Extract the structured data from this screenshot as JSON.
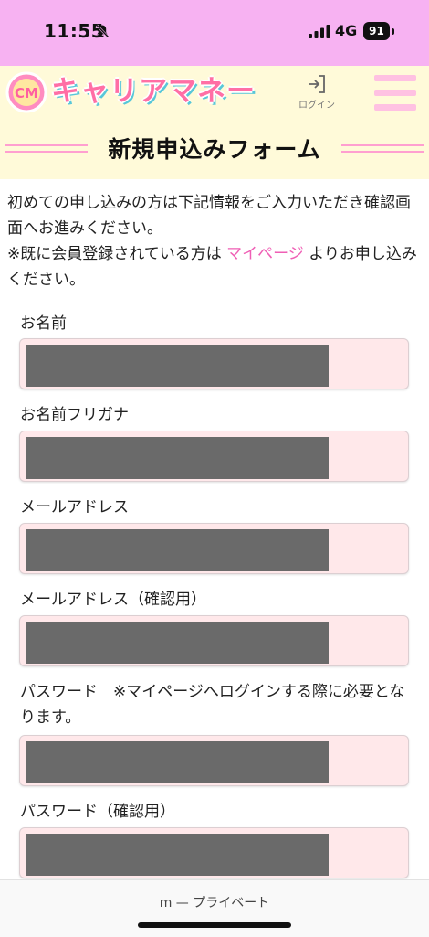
{
  "status_bar": {
    "time": "11:55",
    "network": "4G",
    "battery": "91"
  },
  "header": {
    "logo_mark": "CM",
    "logo_text": "キャリアマネー",
    "login_label": "ログイン"
  },
  "title": "新規申込みフォーム",
  "intro": {
    "line1": "初めての申し込みの方は下記情報をご入力いただき確認画面へお進みください。",
    "line2_prefix": "※既に会員登録されている方は ",
    "mypage_link": "マイページ",
    "line2_suffix": " よりお申し込みください。"
  },
  "form": {
    "fields": [
      {
        "label": "お名前"
      },
      {
        "label": "お名前フリガナ"
      },
      {
        "label": "メールアドレス"
      },
      {
        "label": "メールアドレス（確認用）"
      },
      {
        "label": "パスワード　※マイページへログインする際に必要となります。"
      },
      {
        "label": "パスワード（確認用）"
      }
    ]
  },
  "browser": {
    "url": "m — プライベート"
  },
  "colors": {
    "status_bar_bg": "#f7b2f2",
    "header_bg": "#fffad9",
    "accent_pink": "#ef5fb5",
    "input_bg": "#ffe8ea",
    "redaction": "#6a6a6a"
  }
}
